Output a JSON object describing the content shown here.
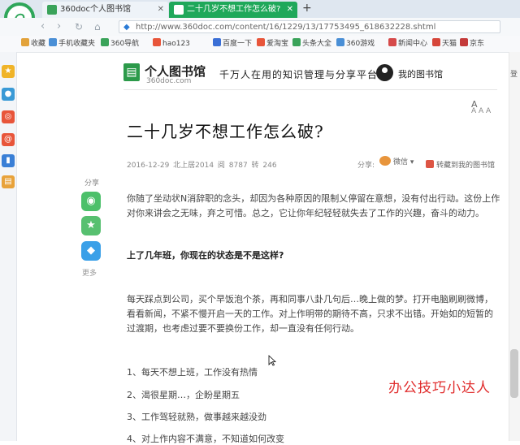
{
  "browser": {
    "tabs": [
      {
        "label": "360doc个人图书馆",
        "active": false
      },
      {
        "label": "二十几岁不想工作怎么破?",
        "active": true
      }
    ],
    "new_tab_label": "+",
    "url": "http://www.360doc.com/content/16/1229/13/17753495_618632228.shtml",
    "bookmarks": [
      "收藏",
      "手机收藏夹",
      "360导航",
      "hao123",
      "百度一下",
      "爱淘宝",
      "头条大全",
      "360游戏",
      "新闻中心",
      "天猫",
      "京东"
    ],
    "bookmark_colors": [
      "#e2a23a",
      "#4a8fd6",
      "#3aa35a",
      "#e8553a",
      "#3a6fd6",
      "#e8553a",
      "#3aa35a",
      "#4a8fd6",
      "#d64a4a",
      "#d6463a",
      "#c43a3a"
    ],
    "sidebar_icon_colors": [
      "#f0b429",
      "#3a9ad6",
      "#e8553a",
      "#e8553a",
      "#3a7fd6",
      "#e8a23a"
    ]
  },
  "site": {
    "name": "个人图书馆",
    "domain": "360doc.com",
    "slogan": "千万人在用的知识管理与分享平台",
    "my_library": "我的图书馆",
    "font_a": "A",
    "font_size_label": "A A A"
  },
  "article": {
    "title": "二十几岁不想工作怎么破?",
    "meta": "2016-12-29  北上居2014  阅 8787  转 246",
    "share_label": "分享:",
    "wechat_label": "微信 ▾",
    "save_label": "转藏到我的图书馆",
    "paragraphs": [
      "你随了坐动状N消辞职的念头，却因为各种原因的限制乂停留在意想，没有付出行动。这份上作对你来讲会之无味，弃之可惜。总之，它让你年纪轻轻就失去了工作的兴趣，奋斗的动力。",
      "每天踩点到公司，买个早饭泡个茶，再和同事八卦几句后…晚上做的梦。打开电脑刷刷微博，看看新闻，不紧不慢开启一天的工作。对上作明带的期待不高，只求不出错。开始如的短暂的过渡期，也考虑过要不要换份工作，却一直没有任何行动。"
    ],
    "subheading": "上了几年班，你现在的状态是不是这样?",
    "list": [
      "1、每天不想上班，工作没有热情",
      "2、渴很星期…，企盼星期五",
      "3、工作驾轻就熟，做事越来越没劲",
      "4、对上作内容不满意，不知道如何改变"
    ]
  },
  "float_share": {
    "label": "分享",
    "more": "更多",
    "buttons": [
      {
        "icon": "wechat-icon",
        "glyph": "◉",
        "color": "#4cc06a"
      },
      {
        "icon": "star-icon",
        "glyph": "★",
        "color": "#57c070"
      },
      {
        "icon": "qq-icon",
        "glyph": "◆",
        "color": "#3aa0e8"
      }
    ]
  },
  "watermark": "办公技巧小达人",
  "right_edge_text": "登"
}
